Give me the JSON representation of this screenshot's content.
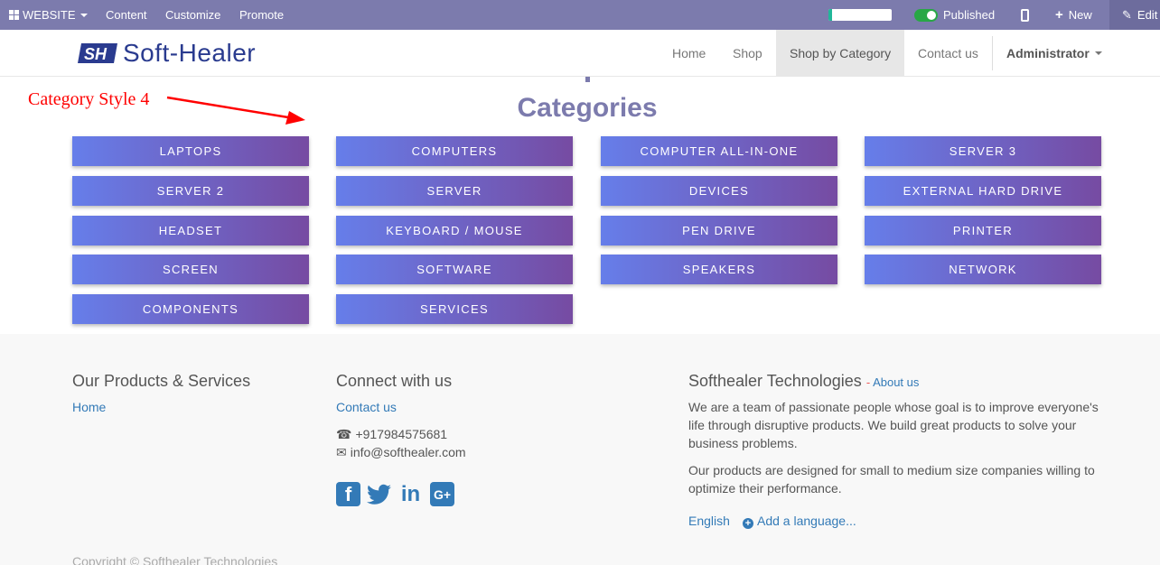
{
  "topbar": {
    "website_label": "WEBSITE",
    "content_label": "Content",
    "customize_label": "Customize",
    "promote_label": "Promote",
    "progress_fraction": 0.05,
    "published_label": "Published",
    "new_label": "New",
    "edit_label": "Edit"
  },
  "navbar": {
    "logo_mark": "SH",
    "logo_text": "Soft-Healer",
    "items": [
      {
        "label": "Home"
      },
      {
        "label": "Shop"
      },
      {
        "label": "Shop by Category"
      },
      {
        "label": "Contact us"
      }
    ],
    "active_item": "Shop by Category",
    "user_label": "Administrator"
  },
  "annotation": {
    "text": "Category Style 4",
    "color": "#ff0000"
  },
  "categories": {
    "title": "Categories",
    "items": [
      "LAPTOPS",
      "COMPUTERS",
      "COMPUTER ALL-IN-ONE",
      "SERVER 3",
      "SERVER 2",
      "SERVER",
      "DEVICES",
      "EXTERNAL HARD DRIVE",
      "HEADSET",
      "KEYBOARD / MOUSE",
      "PEN DRIVE",
      "PRINTER",
      "SCREEN",
      "SOFTWARE",
      "SPEAKERS",
      "NETWORK",
      "COMPONENTS",
      "SERVICES"
    ],
    "gradient_start": "#667eea",
    "gradient_end": "#764ba2"
  },
  "footer": {
    "col1": {
      "heading": "Our Products & Services",
      "links": [
        "Home"
      ]
    },
    "col2": {
      "heading": "Connect with us",
      "contact_link": "Contact us",
      "phone": "+917984575681",
      "email": "info@softhealer.com",
      "social_icons": [
        "facebook-icon",
        "twitter-icon",
        "linkedin-icon",
        "google-plus-icon"
      ]
    },
    "col3": {
      "heading": "Softhealer Technologies",
      "about_link": "About us",
      "para1": "We are a team of passionate people whose goal is to improve everyone's life through disruptive products. We build great products to solve your business problems.",
      "para2": "Our products are designed for small to medium size companies willing to optimize their performance.",
      "language": "English",
      "add_language": "Add a language..."
    },
    "copyright": "Copyright © Softhealer Technologies"
  },
  "colors": {
    "topbar": "#7c7bad",
    "link": "#337ab7",
    "title": "#7c7bad"
  }
}
